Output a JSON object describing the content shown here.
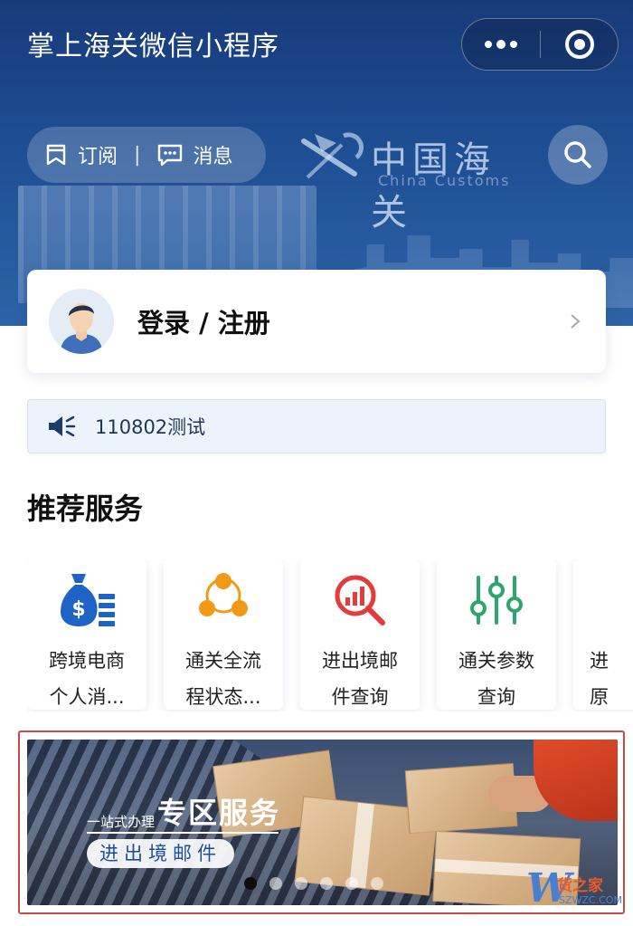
{
  "header": {
    "title": "掌上海关微信小程序",
    "subscribe_label": "订阅",
    "divider": "|",
    "message_label": "消息",
    "logo_cn": "中国海关",
    "logo_en": "China Customs"
  },
  "login": {
    "label": "登录 / 注册"
  },
  "notice": {
    "text": "110802测试"
  },
  "recommended": {
    "title": "推荐服务",
    "services": [
      {
        "line1": "跨境电商",
        "line2": "个人消...",
        "icon": "money-bag-icon",
        "color": "#1f63c6"
      },
      {
        "line1": "通关全流",
        "line2": "程状态...",
        "icon": "network-nodes-icon",
        "color": "#f29a16"
      },
      {
        "line1": "进出境邮",
        "line2": "件查询",
        "icon": "magnifier-chart-icon",
        "color": "#e43c3c"
      },
      {
        "line1": "通关参数",
        "line2": "查询",
        "icon": "sliders-icon",
        "color": "#2ea56d"
      },
      {
        "line1": "进",
        "line2": "原",
        "icon": "partial-icon",
        "color": "#999999"
      }
    ]
  },
  "banner": {
    "tag": "一站式办理",
    "title": "专区服务",
    "chip": "进出境邮件",
    "slide_count": 6,
    "active_slide": 1
  },
  "watermark": {
    "letter": "W",
    "cn": "货之家",
    "sub": "SZWZC.COM"
  }
}
